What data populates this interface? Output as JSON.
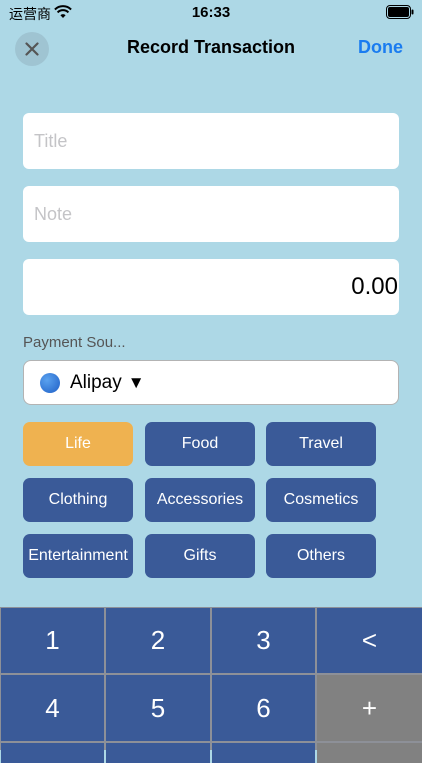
{
  "status_bar": {
    "carrier": "运营商",
    "time": "16:33"
  },
  "nav": {
    "title": "Record Transaction",
    "done_label": "Done"
  },
  "form": {
    "title_placeholder": "Title",
    "note_placeholder": "Note",
    "amount_value": "0.00",
    "payment_label": "Payment Sou...",
    "payment_selected": "Alipay",
    "payment_caret": "▼"
  },
  "categories": [
    {
      "label": "Life",
      "selected": true
    },
    {
      "label": "Food",
      "selected": false
    },
    {
      "label": "Travel",
      "selected": false
    },
    {
      "label": "Clothing",
      "selected": false
    },
    {
      "label": "Accessories",
      "selected": false
    },
    {
      "label": "Cosmetics",
      "selected": false
    },
    {
      "label": "Entertainment",
      "selected": false
    },
    {
      "label": "Gifts",
      "selected": false
    },
    {
      "label": "Others",
      "selected": false
    }
  ],
  "keypad": {
    "keys": [
      "1",
      "2",
      "3",
      "<",
      "4",
      "5",
      "6",
      "+"
    ]
  },
  "colors": {
    "background": "#add8e6",
    "accent": "#1a7cf0",
    "category": "#3a5a98",
    "category_selected": "#efb250",
    "key_gray": "#818181"
  },
  "icons": {
    "close": "close-icon",
    "wifi": "wifi-icon",
    "battery": "battery-icon",
    "payment": "blue-circle-icon"
  }
}
